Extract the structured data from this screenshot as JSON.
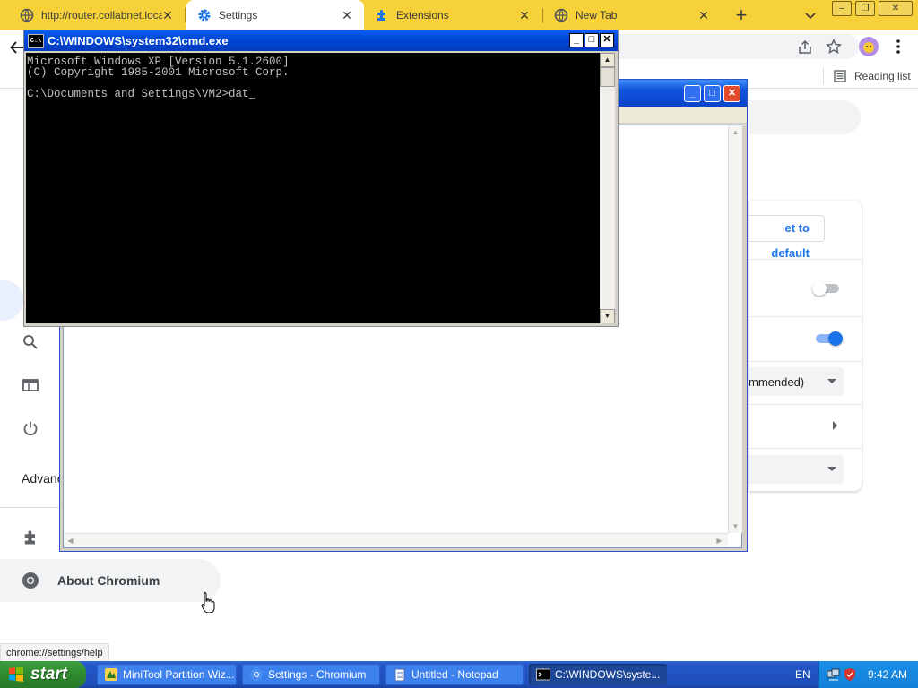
{
  "browser": {
    "tabs": [
      {
        "label": "http://router.collabnet.local/",
        "icon": "globe-icon",
        "active": false
      },
      {
        "label": "Settings",
        "icon": "gear-icon",
        "active": true
      },
      {
        "label": "Extensions",
        "icon": "puzzle-icon",
        "active": false
      },
      {
        "label": "New Tab",
        "icon": "globe-icon",
        "active": false
      }
    ],
    "new_tab_label": "+",
    "tab_search_icon": "chevron-down-icon",
    "window_controls": {
      "minimize": "–",
      "restore": "❐",
      "close": "✕"
    },
    "toolbar": {
      "back_icon": "back-arrow-icon",
      "share_icon": "share-icon",
      "star_icon": "star-icon",
      "profile_icon": "avatar",
      "menu_icon": "kebab-menu-icon"
    },
    "reading_list_label": "Reading list",
    "status_url": "chrome://settings/help"
  },
  "settings": {
    "reset_button_label": "et to default",
    "dropdown_value": "mmended)",
    "advanced_label": "Advanc",
    "about_label": "About Chromium",
    "toggle_off_state": false,
    "toggle_on_state": true,
    "accent_color": "#1a73e8"
  },
  "cmd": {
    "title": "C:\\WINDOWS\\system32\\cmd.exe",
    "icon_label": "C:\\",
    "lines": [
      "Microsoft Windows XP [Version 5.1.2600]",
      "(C) Copyright 1985-2001 Microsoft Corp.",
      "",
      "C:\\Documents and Settings\\VM2>dat"
    ],
    "cursor": "_",
    "controls": {
      "minimize": "_",
      "maximize": "□",
      "close": "✕"
    }
  },
  "backwindow": {
    "controls": {
      "minimize": "_",
      "maximize": "□",
      "close": "✕"
    }
  },
  "taskbar": {
    "start_label": "start",
    "buttons": [
      {
        "label": "MiniTool Partition Wiz...",
        "icon": "minitool-icon",
        "active": false
      },
      {
        "label": "Settings - Chromium",
        "icon": "chromium-icon",
        "active": false
      },
      {
        "label": "Untitled - Notepad",
        "icon": "notepad-icon",
        "active": false
      },
      {
        "label": "C:\\WINDOWS\\syste...",
        "icon": "cmd-icon",
        "active": true
      }
    ],
    "language": "EN",
    "clock": "9:42 AM"
  }
}
